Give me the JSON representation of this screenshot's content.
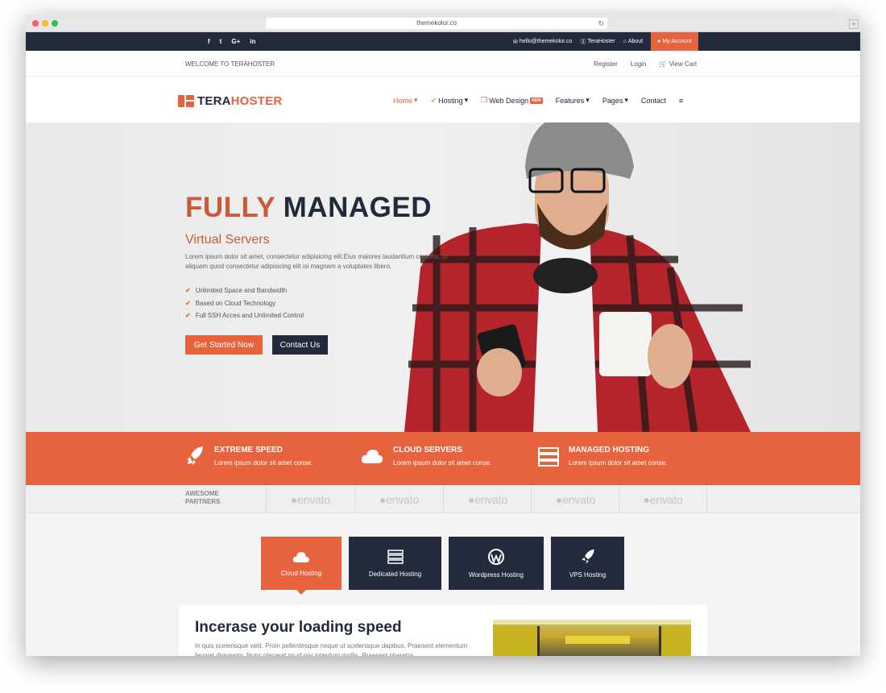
{
  "browser": {
    "url": "themekolor.co"
  },
  "topbar": {
    "social": [
      "f",
      "t",
      "G+",
      "in"
    ],
    "email": "hello@themekolor.co",
    "skype": "TeraHoster",
    "about": "About",
    "account": "My Account"
  },
  "welcome": {
    "text": "WELCOME TO TERAHOSTER",
    "register": "Register",
    "login": "Login",
    "cart": "View Cart"
  },
  "logo": {
    "part1": "TERA",
    "part2": "HOSTER"
  },
  "menu": {
    "items": [
      "Home",
      "Hosting",
      "Web Design",
      "Features",
      "Pages",
      "Contact"
    ],
    "badge": "NEW",
    "menu_icon": "≡"
  },
  "hero": {
    "title_a": "FULLY",
    "title_b": "MANAGED",
    "subtitle": "Virtual Servers",
    "text": "Lorem ipsum dolor sit amet, consectetur adipisicing elit.Eius maiores laudantium corporis, in aliquam quod consectetur adipisicing elit isi magnam a voluptates libero.",
    "checks": [
      "Unlimited Space and Bandwidth",
      "Based on Cloud Technology",
      "Full SSH Acces and Unlimited Control"
    ],
    "primary": "Get Started Now",
    "secondary": "Contact Us"
  },
  "features": [
    {
      "title": "EXTREME SPEED",
      "text": "Lorem ipsum dolor sit amet conse."
    },
    {
      "title": "CLOUD SERVERS",
      "text": "Lorem ipsum dolor sit amet conse."
    },
    {
      "title": "MANAGED HOSTING",
      "text": "Lorem ipsum dolor sit amet conse."
    }
  ],
  "partners": {
    "label": "AWESOME PARTNERS",
    "logos": [
      "envato",
      "envato",
      "envato",
      "envato",
      "envato"
    ]
  },
  "tabs": [
    "Cloud Hosting",
    "Dedicated Hosting",
    "Wordpress Hosting",
    "VPS Hosting"
  ],
  "section": {
    "title": "Incerase your loading speed",
    "text": "In quis scelerisque velit. Proin pellentesque neque ut scelerisque dapibus. Praesent elementum feugiat dignissim. Nunc placerat mi id nisi interdum mollis. Praesent pharetra"
  },
  "colors": {
    "accent": "#e6633e",
    "dark": "#222b3b"
  }
}
